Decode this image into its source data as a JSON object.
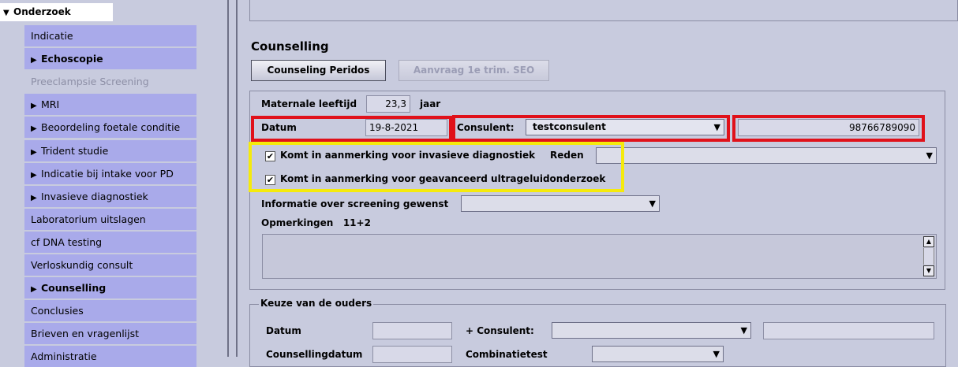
{
  "sidebar": {
    "header": "Onderzoek",
    "items": [
      {
        "label": "Indicatie",
        "expandable": false,
        "bold": false,
        "disabled": false
      },
      {
        "label": "Echoscopie",
        "expandable": true,
        "bold": true,
        "disabled": false
      },
      {
        "label": "Preeclampsie Screening",
        "expandable": false,
        "bold": false,
        "disabled": true
      },
      {
        "label": "MRI",
        "expandable": true,
        "bold": false,
        "disabled": false
      },
      {
        "label": "Beoordeling foetale conditie",
        "expandable": true,
        "bold": false,
        "disabled": false
      },
      {
        "label": "Trident studie",
        "expandable": true,
        "bold": false,
        "disabled": false
      },
      {
        "label": "Indicatie bij intake voor PD",
        "expandable": true,
        "bold": false,
        "disabled": false
      },
      {
        "label": "Invasieve diagnostiek",
        "expandable": true,
        "bold": false,
        "disabled": false
      },
      {
        "label": "Laboratorium uitslagen",
        "expandable": false,
        "bold": false,
        "disabled": false
      },
      {
        "label": "cf DNA testing",
        "expandable": false,
        "bold": false,
        "disabled": false
      },
      {
        "label": "Verloskundig consult",
        "expandable": false,
        "bold": false,
        "disabled": false
      },
      {
        "label": "Counselling",
        "expandable": true,
        "bold": true,
        "disabled": false
      },
      {
        "label": "Conclusies",
        "expandable": false,
        "bold": false,
        "disabled": false
      },
      {
        "label": "Brieven en vragenlijst",
        "expandable": false,
        "bold": false,
        "disabled": false
      },
      {
        "label": "Administratie",
        "expandable": false,
        "bold": false,
        "disabled": false
      }
    ]
  },
  "counselling": {
    "title": "Counselling",
    "btn_peridos": "Counseling Peridos",
    "btn_aanvraag": "Aanvraag 1e trim. SEO",
    "maternale_label": "Maternale leeftijd",
    "maternale_value": "23,3",
    "maternale_unit": "jaar",
    "datum_label": "Datum",
    "datum_value": "19-8-2021",
    "consulent_label": "Consulent:",
    "consulent_value": "testconsulent",
    "consulent_code": "98766789090",
    "chk_invasief": "Komt in aanmerking voor invasieve diagnostiek",
    "reden_label": "Reden",
    "chk_ultrageluid": "Komt in aanmerking voor geavanceerd ultrageluidonderzoek",
    "informatie_label": "Informatie over screening gewenst",
    "opmerkingen_label": "Opmerkingen",
    "opmerkingen_value": "11+2"
  },
  "keuze": {
    "legend": "Keuze van de ouders",
    "datum_label": "Datum",
    "plus_consulent_label": "+  Consulent:",
    "counsellingdatum_label": "Counsellingdatum",
    "combinatietest_label": "Combinatietest"
  },
  "icons": {
    "triangle_right": "▶",
    "triangle_down": "▼",
    "check": "✔",
    "scroll_up": "▲",
    "scroll_down": "▼"
  },
  "colors": {
    "sidebar_item_bg": "#a9aaea",
    "highlight_red": "#e0111a",
    "highlight_yellow": "#f5ea0c",
    "background": "#c8cbde"
  }
}
